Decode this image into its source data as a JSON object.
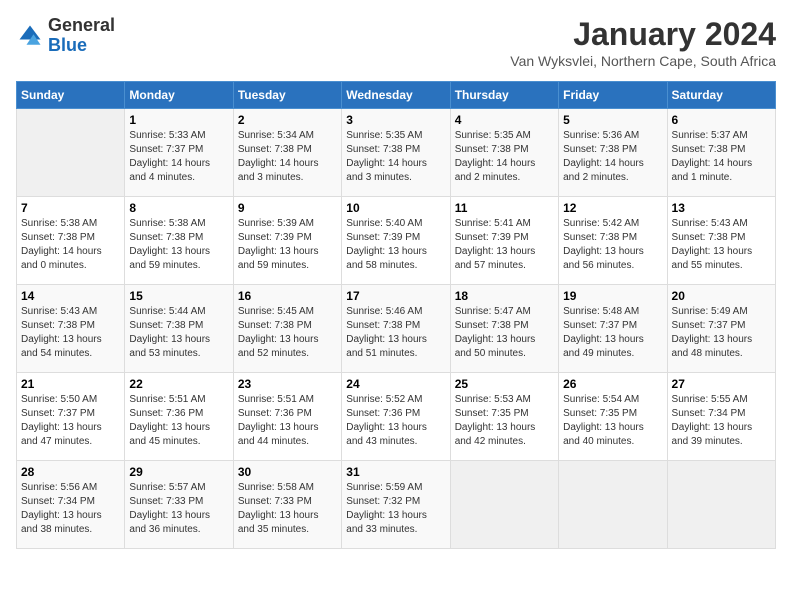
{
  "header": {
    "logo_line1": "General",
    "logo_line2": "Blue",
    "month": "January 2024",
    "location": "Van Wyksvlei, Northern Cape, South Africa"
  },
  "weekdays": [
    "Sunday",
    "Monday",
    "Tuesday",
    "Wednesday",
    "Thursday",
    "Friday",
    "Saturday"
  ],
  "weeks": [
    [
      {
        "day": null,
        "sunrise": null,
        "sunset": null,
        "daylight": null
      },
      {
        "day": "1",
        "sunrise": "Sunrise: 5:33 AM",
        "sunset": "Sunset: 7:37 PM",
        "daylight": "Daylight: 14 hours and 4 minutes."
      },
      {
        "day": "2",
        "sunrise": "Sunrise: 5:34 AM",
        "sunset": "Sunset: 7:38 PM",
        "daylight": "Daylight: 14 hours and 3 minutes."
      },
      {
        "day": "3",
        "sunrise": "Sunrise: 5:35 AM",
        "sunset": "Sunset: 7:38 PM",
        "daylight": "Daylight: 14 hours and 3 minutes."
      },
      {
        "day": "4",
        "sunrise": "Sunrise: 5:35 AM",
        "sunset": "Sunset: 7:38 PM",
        "daylight": "Daylight: 14 hours and 2 minutes."
      },
      {
        "day": "5",
        "sunrise": "Sunrise: 5:36 AM",
        "sunset": "Sunset: 7:38 PM",
        "daylight": "Daylight: 14 hours and 2 minutes."
      },
      {
        "day": "6",
        "sunrise": "Sunrise: 5:37 AM",
        "sunset": "Sunset: 7:38 PM",
        "daylight": "Daylight: 14 hours and 1 minute."
      }
    ],
    [
      {
        "day": "7",
        "sunrise": "Sunrise: 5:38 AM",
        "sunset": "Sunset: 7:38 PM",
        "daylight": "Daylight: 14 hours and 0 minutes."
      },
      {
        "day": "8",
        "sunrise": "Sunrise: 5:38 AM",
        "sunset": "Sunset: 7:38 PM",
        "daylight": "Daylight: 13 hours and 59 minutes."
      },
      {
        "day": "9",
        "sunrise": "Sunrise: 5:39 AM",
        "sunset": "Sunset: 7:39 PM",
        "daylight": "Daylight: 13 hours and 59 minutes."
      },
      {
        "day": "10",
        "sunrise": "Sunrise: 5:40 AM",
        "sunset": "Sunset: 7:39 PM",
        "daylight": "Daylight: 13 hours and 58 minutes."
      },
      {
        "day": "11",
        "sunrise": "Sunrise: 5:41 AM",
        "sunset": "Sunset: 7:39 PM",
        "daylight": "Daylight: 13 hours and 57 minutes."
      },
      {
        "day": "12",
        "sunrise": "Sunrise: 5:42 AM",
        "sunset": "Sunset: 7:38 PM",
        "daylight": "Daylight: 13 hours and 56 minutes."
      },
      {
        "day": "13",
        "sunrise": "Sunrise: 5:43 AM",
        "sunset": "Sunset: 7:38 PM",
        "daylight": "Daylight: 13 hours and 55 minutes."
      }
    ],
    [
      {
        "day": "14",
        "sunrise": "Sunrise: 5:43 AM",
        "sunset": "Sunset: 7:38 PM",
        "daylight": "Daylight: 13 hours and 54 minutes."
      },
      {
        "day": "15",
        "sunrise": "Sunrise: 5:44 AM",
        "sunset": "Sunset: 7:38 PM",
        "daylight": "Daylight: 13 hours and 53 minutes."
      },
      {
        "day": "16",
        "sunrise": "Sunrise: 5:45 AM",
        "sunset": "Sunset: 7:38 PM",
        "daylight": "Daylight: 13 hours and 52 minutes."
      },
      {
        "day": "17",
        "sunrise": "Sunrise: 5:46 AM",
        "sunset": "Sunset: 7:38 PM",
        "daylight": "Daylight: 13 hours and 51 minutes."
      },
      {
        "day": "18",
        "sunrise": "Sunrise: 5:47 AM",
        "sunset": "Sunset: 7:38 PM",
        "daylight": "Daylight: 13 hours and 50 minutes."
      },
      {
        "day": "19",
        "sunrise": "Sunrise: 5:48 AM",
        "sunset": "Sunset: 7:37 PM",
        "daylight": "Daylight: 13 hours and 49 minutes."
      },
      {
        "day": "20",
        "sunrise": "Sunrise: 5:49 AM",
        "sunset": "Sunset: 7:37 PM",
        "daylight": "Daylight: 13 hours and 48 minutes."
      }
    ],
    [
      {
        "day": "21",
        "sunrise": "Sunrise: 5:50 AM",
        "sunset": "Sunset: 7:37 PM",
        "daylight": "Daylight: 13 hours and 47 minutes."
      },
      {
        "day": "22",
        "sunrise": "Sunrise: 5:51 AM",
        "sunset": "Sunset: 7:36 PM",
        "daylight": "Daylight: 13 hours and 45 minutes."
      },
      {
        "day": "23",
        "sunrise": "Sunrise: 5:51 AM",
        "sunset": "Sunset: 7:36 PM",
        "daylight": "Daylight: 13 hours and 44 minutes."
      },
      {
        "day": "24",
        "sunrise": "Sunrise: 5:52 AM",
        "sunset": "Sunset: 7:36 PM",
        "daylight": "Daylight: 13 hours and 43 minutes."
      },
      {
        "day": "25",
        "sunrise": "Sunrise: 5:53 AM",
        "sunset": "Sunset: 7:35 PM",
        "daylight": "Daylight: 13 hours and 42 minutes."
      },
      {
        "day": "26",
        "sunrise": "Sunrise: 5:54 AM",
        "sunset": "Sunset: 7:35 PM",
        "daylight": "Daylight: 13 hours and 40 minutes."
      },
      {
        "day": "27",
        "sunrise": "Sunrise: 5:55 AM",
        "sunset": "Sunset: 7:34 PM",
        "daylight": "Daylight: 13 hours and 39 minutes."
      }
    ],
    [
      {
        "day": "28",
        "sunrise": "Sunrise: 5:56 AM",
        "sunset": "Sunset: 7:34 PM",
        "daylight": "Daylight: 13 hours and 38 minutes."
      },
      {
        "day": "29",
        "sunrise": "Sunrise: 5:57 AM",
        "sunset": "Sunset: 7:33 PM",
        "daylight": "Daylight: 13 hours and 36 minutes."
      },
      {
        "day": "30",
        "sunrise": "Sunrise: 5:58 AM",
        "sunset": "Sunset: 7:33 PM",
        "daylight": "Daylight: 13 hours and 35 minutes."
      },
      {
        "day": "31",
        "sunrise": "Sunrise: 5:59 AM",
        "sunset": "Sunset: 7:32 PM",
        "daylight": "Daylight: 13 hours and 33 minutes."
      },
      {
        "day": null,
        "sunrise": null,
        "sunset": null,
        "daylight": null
      },
      {
        "day": null,
        "sunrise": null,
        "sunset": null,
        "daylight": null
      },
      {
        "day": null,
        "sunrise": null,
        "sunset": null,
        "daylight": null
      }
    ]
  ]
}
